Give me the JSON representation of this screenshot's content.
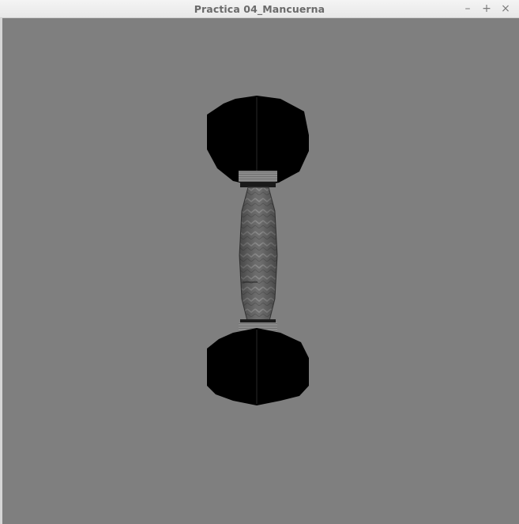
{
  "window": {
    "title": "Practica 04_Mancuerna",
    "controls": {
      "minimize": "–",
      "maximize": "+",
      "close": "×"
    }
  },
  "scene": {
    "background_color": "#7f7f7f",
    "object": "dumbbell",
    "plate_color": "#000000",
    "handle_color": "#6e6e6e",
    "collar_color": "#8a8a8a"
  }
}
